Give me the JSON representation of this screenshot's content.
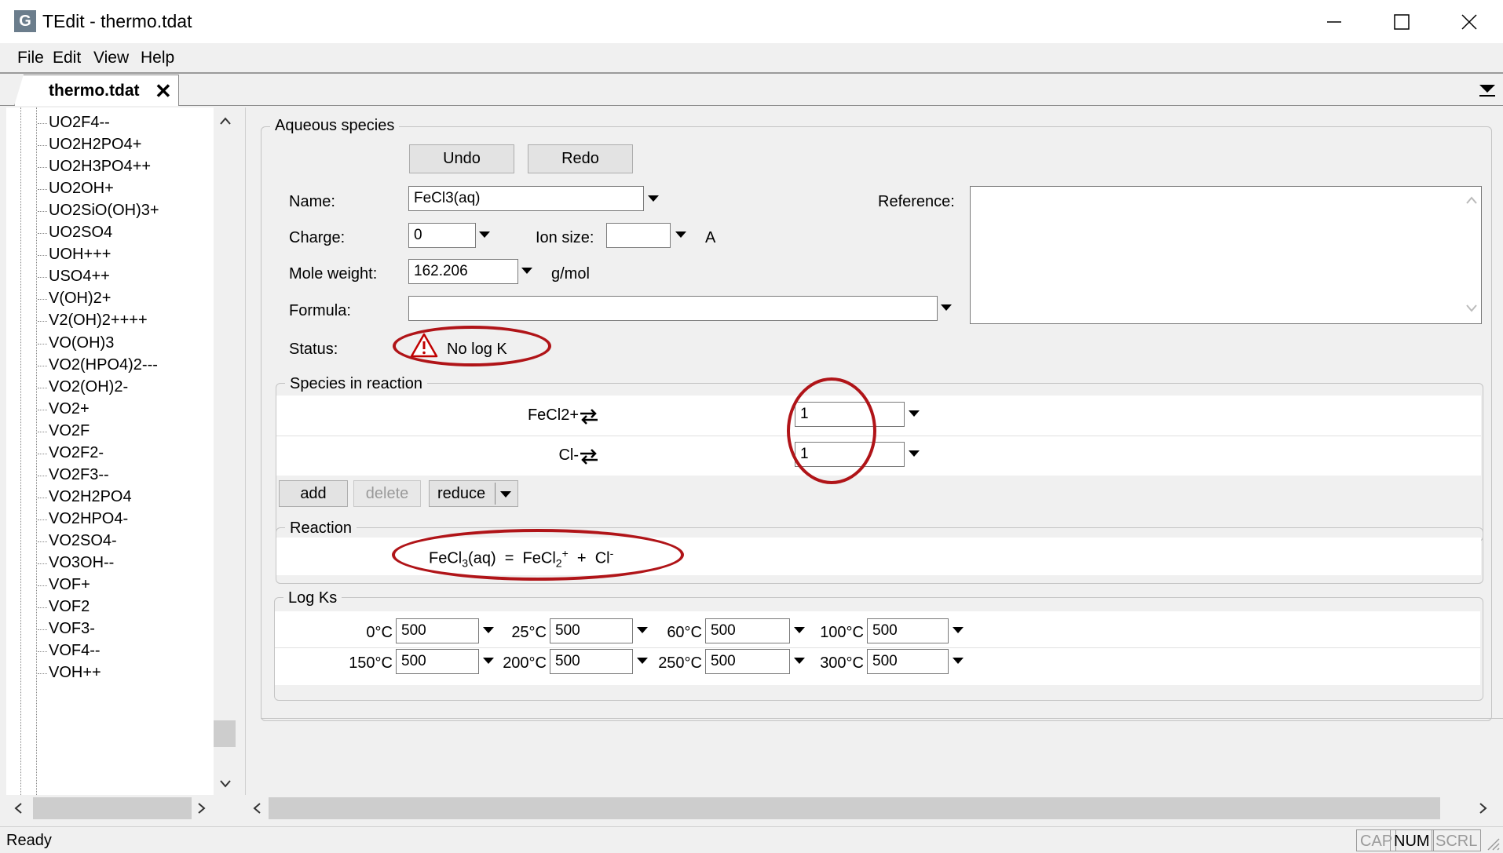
{
  "window": {
    "title": "TEdit - thermo.tdat",
    "app_icon_letter": "G"
  },
  "menu": [
    "File",
    "Edit",
    "View",
    "Help"
  ],
  "tab": {
    "label": "thermo.tdat",
    "close": "✕"
  },
  "tree": {
    "items": [
      "UO2F4--",
      "UO2H2PO4+",
      "UO2H3PO4++",
      "UO2OH+",
      "UO2SiO(OH)3+",
      "UO2SO4",
      "UOH+++",
      "USO4++",
      "V(OH)2+",
      "V2(OH)2++++",
      "VO(OH)3",
      "VO2(HPO4)2---",
      "VO2(OH)2-",
      "VO2+",
      "VO2F",
      "VO2F2-",
      "VO2F3--",
      "VO2H2PO4",
      "VO2HPO4-",
      "VO2SO4-",
      "VO3OH--",
      "VOF+",
      "VOF2",
      "VOF3-",
      "VOF4--",
      "VOH++"
    ]
  },
  "aqueous": {
    "legend": "Aqueous species",
    "undo": "Undo",
    "redo": "Redo",
    "name_label": "Name:",
    "name_value": "FeCl3(aq)",
    "reference_label": "Reference:",
    "charge_label": "Charge:",
    "charge_value": "0",
    "ionsize_label": "Ion size:",
    "ionsize_value": "",
    "ionsize_unit": "A",
    "moleweight_label": "Mole weight:",
    "moleweight_value": "162.206",
    "moleweight_unit": "g/mol",
    "formula_label": "Formula:",
    "formula_value": "",
    "status_label": "Status:",
    "status_text": "No log K"
  },
  "species": {
    "legend": "Species in reaction",
    "rows": [
      {
        "name": "FeCl2+",
        "coef": "1"
      },
      {
        "name": "Cl-",
        "coef": "1"
      }
    ],
    "add": "add",
    "delete": "delete",
    "reduce": "reduce"
  },
  "reaction": {
    "legend": "Reaction",
    "lhs": "FeCl",
    "lhs_sub": "3",
    "lhs_tail": "(aq)",
    "eq": "=",
    "p1": "FeCl",
    "p1_sub": "2",
    "p1_sup": "+",
    "plus": "+",
    "p2": "Cl",
    "p2_sup": "-"
  },
  "logks": {
    "legend": "Log Ks",
    "temps": [
      "0°C",
      "25°C",
      "60°C",
      "100°C",
      "150°C",
      "200°C",
      "250°C",
      "300°C"
    ],
    "values": [
      "500",
      "500",
      "500",
      "500",
      "500",
      "500",
      "500",
      "500"
    ]
  },
  "status_bar": {
    "text": "Ready",
    "indicators": [
      "CAP",
      "NUM",
      "SCRL"
    ]
  },
  "colors": {
    "highlight_ring": "#b01418",
    "warning": "#c00000"
  }
}
